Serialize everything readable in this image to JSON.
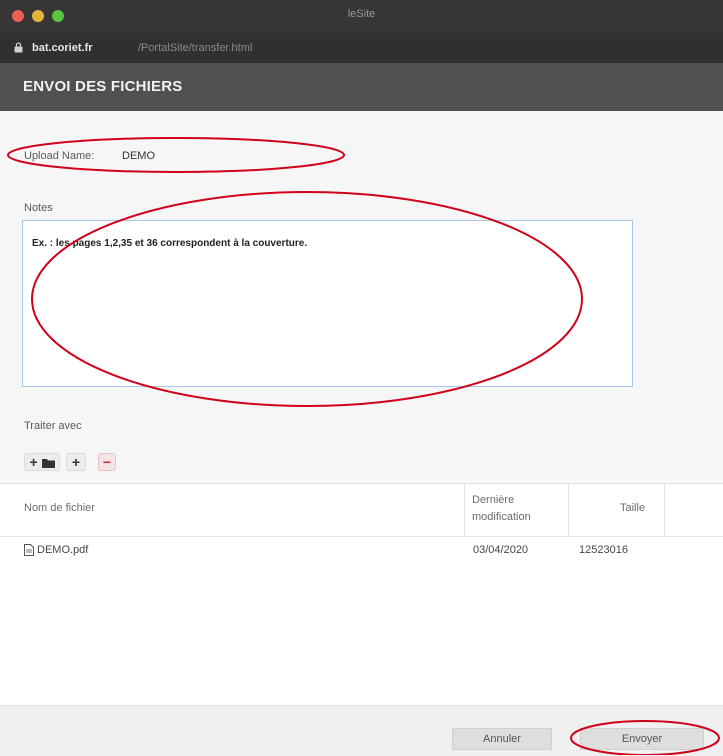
{
  "window": {
    "title": "leSite",
    "url_host": "bat.coriet.fr",
    "url_path": "/PortalSite/transfer.html"
  },
  "header": {
    "title": "ENVOI DES FICHIERS"
  },
  "form": {
    "upload_name_label": "Upload Name:",
    "upload_name_value": "DEMO",
    "notes_label": "Notes",
    "notes_text": "Ex. : les pages 1,2,35 et 36 correspondent à la couverture.",
    "traiter_label": "Traiter avec"
  },
  "toolbar": {
    "add_folder_label": "+",
    "add_label": "+",
    "remove_label": "−"
  },
  "table": {
    "columns": [
      "Nom de fichier",
      "Dernière modification",
      "Taille"
    ],
    "rows": [
      {
        "name": "DEMO.pdf",
        "modified": "03/04/2020",
        "size": "12523016"
      }
    ]
  },
  "footer": {
    "cancel_label": "Annuler",
    "send_label": "Envoyer"
  },
  "colors": {
    "annotation": "#d0021b",
    "header_bg": "#505050",
    "notes_border": "#a9c6e6"
  }
}
